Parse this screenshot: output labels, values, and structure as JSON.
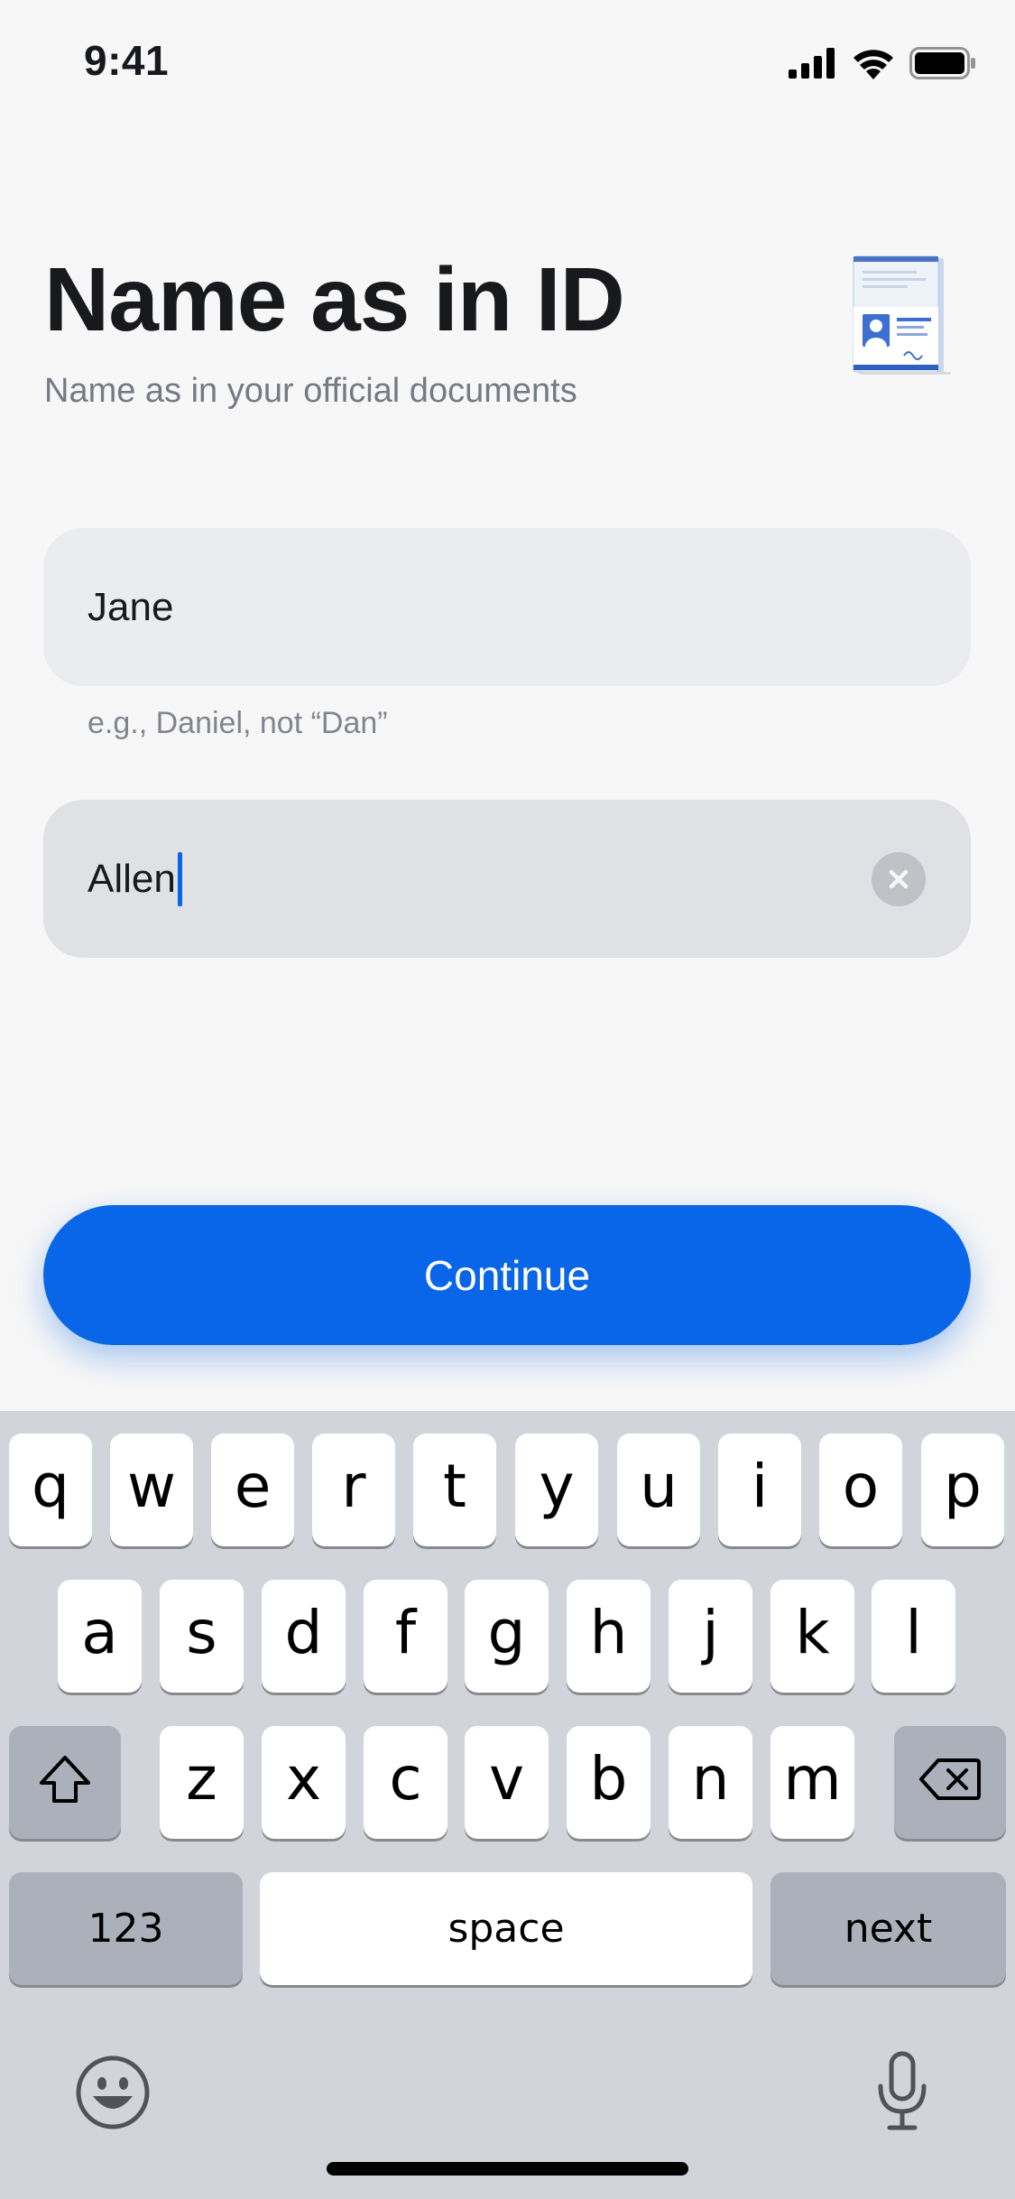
{
  "status_bar": {
    "time": "9:41"
  },
  "header": {
    "title": "Name as in ID",
    "subtitle": "Name as in your official documents"
  },
  "form": {
    "first_name": {
      "value": "Jane",
      "hint": "e.g., Daniel, not “Dan”"
    },
    "last_name": {
      "value": "Allen"
    }
  },
  "actions": {
    "continue_label": "Continue"
  },
  "keyboard": {
    "row1": [
      "q",
      "w",
      "e",
      "r",
      "t",
      "y",
      "u",
      "i",
      "o",
      "p"
    ],
    "row2": [
      "a",
      "s",
      "d",
      "f",
      "g",
      "h",
      "j",
      "k",
      "l"
    ],
    "row3": [
      "z",
      "x",
      "c",
      "v",
      "b",
      "n",
      "m"
    ],
    "numbers_label": "123",
    "space_label": "space",
    "next_label": "next"
  },
  "colors": {
    "accent": "#0a66e8",
    "background": "#f7f7f7",
    "keyboard_bg": "#d1d4da"
  },
  "icons": [
    "signal-icon",
    "wifi-icon",
    "battery-icon",
    "id-document-icon",
    "clear-icon",
    "shift-icon",
    "backspace-icon",
    "emoji-icon",
    "microphone-icon"
  ]
}
